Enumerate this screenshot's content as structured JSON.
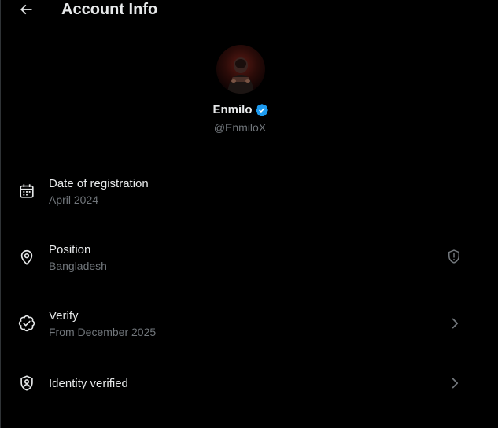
{
  "header": {
    "title": "Account Info",
    "back_icon": "arrow-left-icon"
  },
  "profile": {
    "display_name": "Enmilo",
    "handle": "@EnmiloX",
    "verified_badge_color": "#1d9bf0"
  },
  "rows": [
    {
      "label": "Date of registration",
      "value": "April 2024",
      "icon": "calendar-icon",
      "trail_icon": ""
    },
    {
      "label": "Position",
      "value": "Bangladesh",
      "icon": "location-pin-icon",
      "trail_icon": "shield-alert-icon"
    },
    {
      "label": "Verify",
      "value": "From December 2025",
      "icon": "verified-badge-outline-icon",
      "trail_icon": "chevron-right-icon"
    },
    {
      "label": "Identity verified",
      "value": "",
      "icon": "id-shield-icon",
      "trail_icon": "chevron-right-icon"
    }
  ],
  "colors": {
    "background": "#000000",
    "text_primary": "#e7e9ea",
    "text_secondary": "#71767b",
    "divider": "#2f3336",
    "accent": "#1d9bf0"
  }
}
